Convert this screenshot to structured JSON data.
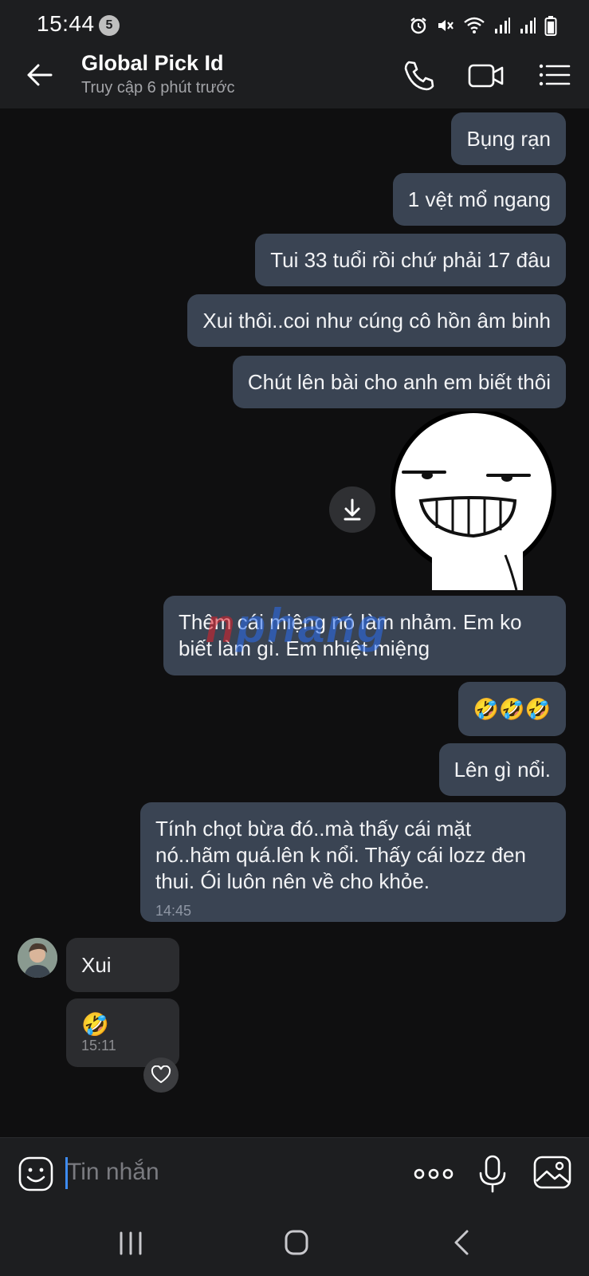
{
  "status_bar": {
    "time": "15:44",
    "notification_count": "5",
    "icons": [
      "alarm-icon",
      "mute-icon",
      "wifi-icon",
      "signal-icon",
      "signal-icon",
      "battery-icon"
    ]
  },
  "header": {
    "title": "Global Pick Id",
    "subtitle": "Truy cập 6 phút trước",
    "icons": [
      "back-arrow-icon",
      "phone-icon",
      "video-call-icon",
      "menu-list-icon"
    ]
  },
  "messages_out": [
    {
      "text": "Bụng rạn"
    },
    {
      "text": "1 vệt mổ ngang"
    },
    {
      "text": "Tui 33 tuổi rồi chứ phải 17 đâu"
    },
    {
      "text": "Xui thôi..coi như cúng cô hồn âm binh"
    },
    {
      "text": "Chút lên bài cho anh em biết thôi"
    },
    {
      "text": "Thêm cái miệng nó làm nhảm. Em ko biết làm gì. Em nhiệt miệng"
    },
    {
      "text": "🤣🤣🤣"
    },
    {
      "text": "Lên gì nổi."
    },
    {
      "text": "Tính chọt bừa đó..mà thấy cái mặt nó..hãm quá.lên k nổi. Thấy cái lozz đen thui. Ói luôn nên về cho khỏe.",
      "time": "14:45"
    }
  ],
  "sticker": {
    "description": "grinning-face-sticker",
    "download_icon": "download-icon"
  },
  "messages_in": [
    {
      "text": "Xui"
    },
    {
      "text": "🤣",
      "time": "15:11"
    }
  ],
  "watermark": {
    "text_red": "n",
    "text_blue": "phang"
  },
  "input_bar": {
    "placeholder": "Tin nhắn",
    "value": "",
    "icons": [
      "sticker-emoji-icon",
      "more-options-icon",
      "microphone-icon",
      "gallery-icon"
    ]
  },
  "nav_bar": {
    "icons": [
      "recent-apps-icon",
      "home-icon",
      "back-icon"
    ]
  },
  "colors": {
    "background": "#0f0f10",
    "bar": "#1d1e20",
    "outgoing_bubble": "#3a4453",
    "incoming_bubble": "#2b2c2f",
    "accent": "#3d8cf5"
  }
}
